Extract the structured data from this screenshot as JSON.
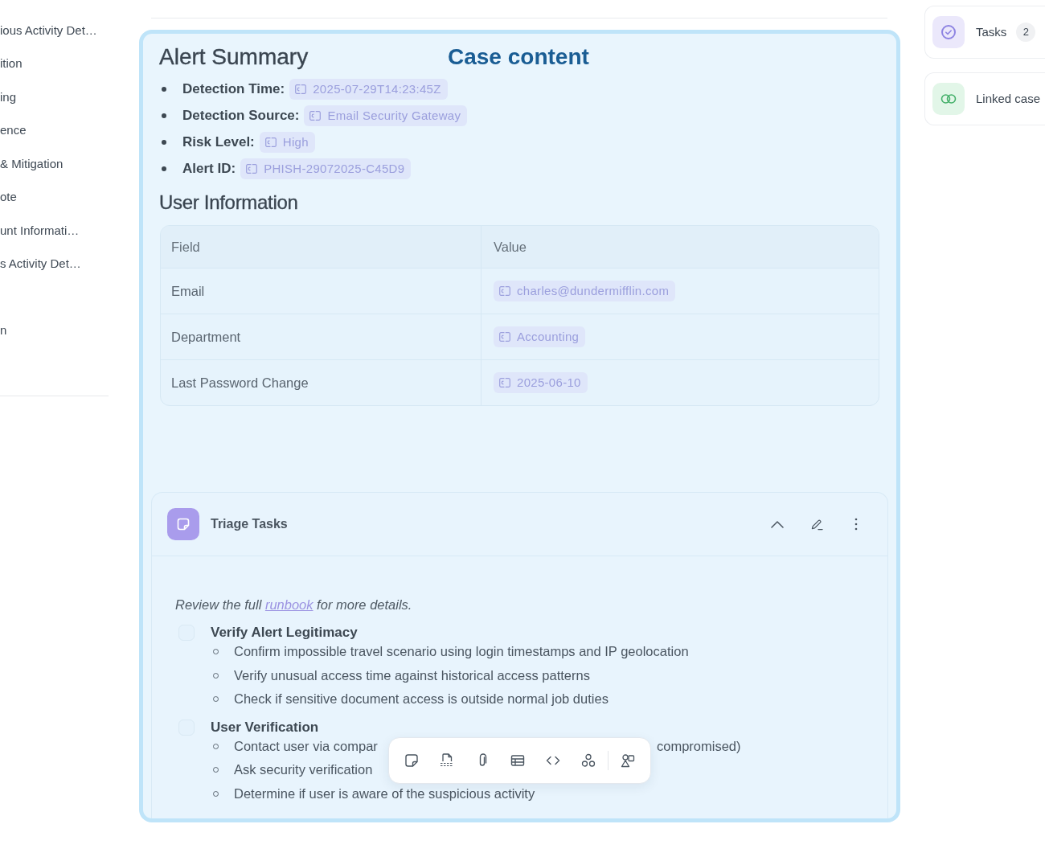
{
  "sidebar": {
    "sections": [
      {
        "items": [
          "ious Activity Det…",
          "ition",
          "ing",
          "ence",
          "& Mitigation",
          "ote",
          "unt Informati…",
          "s Activity Det…"
        ]
      },
      {
        "items": [
          "n"
        ]
      }
    ]
  },
  "case_content": {
    "label": "Case content",
    "alert_summary": {
      "title": "Alert Summary",
      "fields": [
        {
          "label": "Detection Time:",
          "value": "2025-07-29T14:23:45Z"
        },
        {
          "label": "Detection Source:",
          "value": "Email Security Gateway"
        },
        {
          "label": "Risk Level:",
          "value": "High"
        },
        {
          "label": "Alert ID:",
          "value": "PHISH-29072025-C45D9"
        }
      ]
    },
    "user_information": {
      "title": "User Information",
      "table": {
        "columns": [
          {
            "label": "Field",
            "kind": "text"
          },
          {
            "label": "Value",
            "kind": "token"
          }
        ],
        "rows": [
          [
            "Email",
            "charles@dundermifflin.com"
          ],
          [
            "Department",
            "Accounting"
          ],
          [
            "Last Password Change",
            "2025-06-10"
          ]
        ]
      }
    },
    "triage_tasks": {
      "title": "Triage Tasks",
      "expanded": true,
      "intro": {
        "before": "Review the full ",
        "link": "runbook",
        "after": " for more details."
      },
      "tasks": [
        {
          "title": "Verify Alert Legitimacy",
          "checked": false,
          "steps": [
            {
              "text": "Confirm impossible travel scenario using login timestamps and IP geolocation"
            },
            {
              "text": "Verify unusual access time against historical access patterns"
            },
            {
              "text": "Check if sensitive document access is outside normal job duties"
            }
          ]
        },
        {
          "title": "User Verification",
          "checked": false,
          "steps": [
            {
              "text": "Contact user via compar",
              "text_right": "compromised)"
            },
            {
              "text": "Ask security verification"
            },
            {
              "text": "Determine if user is aware of the suspicious activity"
            }
          ]
        }
      ]
    }
  },
  "side_panel": {
    "cards": [
      {
        "kind": "tasks",
        "label": "Tasks",
        "count": "2"
      },
      {
        "kind": "linked_cases",
        "label": "Linked case"
      }
    ]
  }
}
